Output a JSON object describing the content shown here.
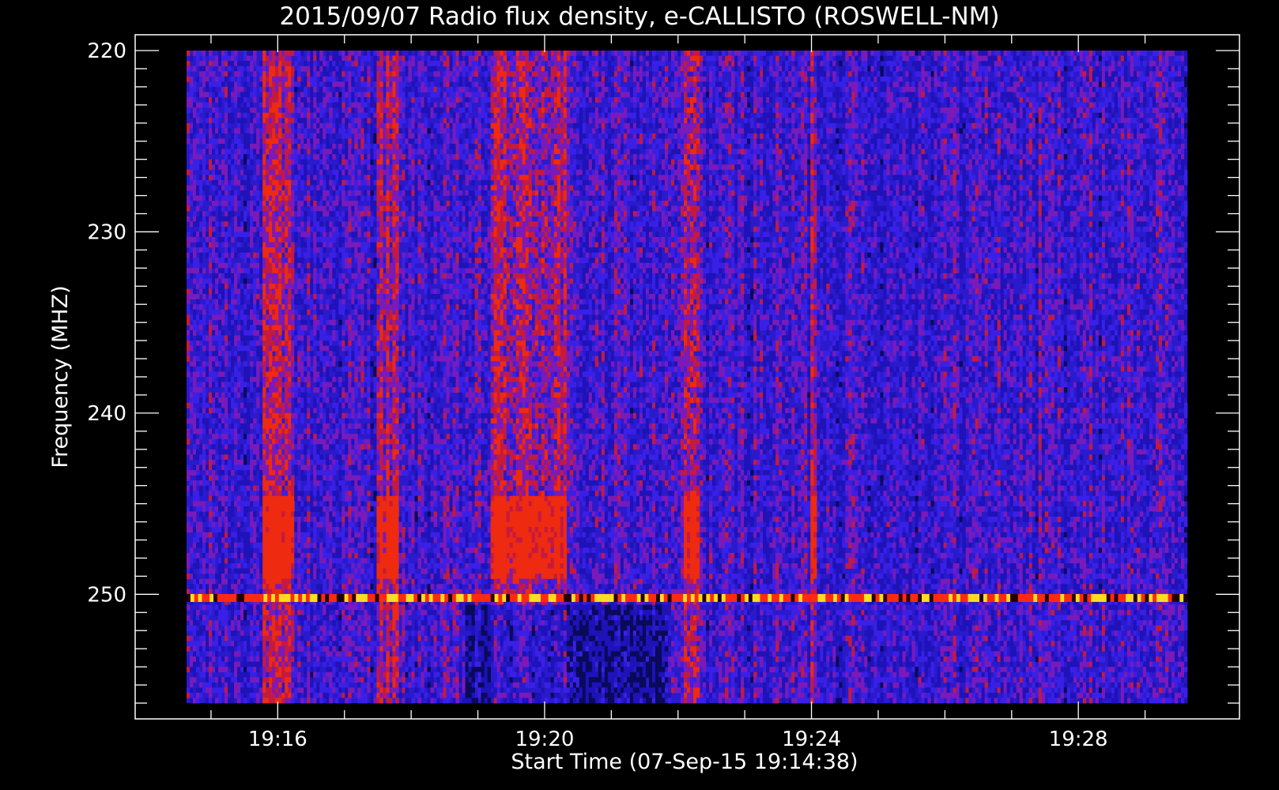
{
  "chart_data": {
    "type": "heatmap",
    "title": "2015/09/07  Radio flux density, e-CALLISTO (ROSWELL-NM)",
    "xlabel": "Start Time (07-Sep-15 19:14:38)",
    "ylabel": "Frequency (MHZ)",
    "start_time": "19:14:38",
    "xlim": [
      "19:14:38",
      "19:29:38"
    ],
    "ylim": [
      256,
      219
    ],
    "xticks": [
      "19:16",
      "19:20",
      "19:24",
      "19:28"
    ],
    "yticks": [
      220,
      230,
      240,
      250
    ],
    "x_minor_interval_seconds": 60,
    "y_minor_interval_mhz": 1,
    "colormap": [
      "#000000",
      "#0000ff",
      "#ff0000",
      "#ffff00"
    ],
    "background_color": "#000000",
    "interference_line_mhz": 250.2,
    "enhanced_time_bands": [
      [
        "19:15:45",
        "19:16:15"
      ],
      [
        "19:17:30",
        "19:17:50"
      ],
      [
        "19:19:10",
        "19:20:20"
      ],
      [
        "19:22:05",
        "19:22:20"
      ],
      [
        "19:24:00",
        "19:24:05"
      ]
    ],
    "enhanced_freq_band_mhz": [
      244.5,
      249.0
    ],
    "quiet_region": {
      "time": [
        "19:18:50",
        "19:21:50"
      ],
      "freq_mhz": [
        250.5,
        256
      ]
    }
  }
}
